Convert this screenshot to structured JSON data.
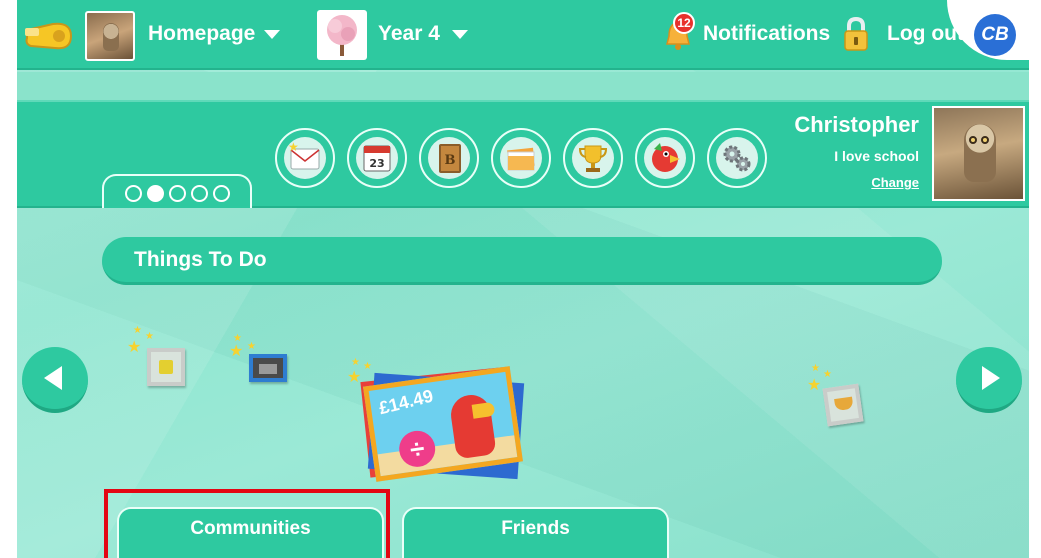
{
  "topbar": {
    "homepage_label": "Homepage",
    "year_label": "Year 4",
    "notifications_label": "Notifications",
    "notifications_count": "12",
    "logout_label": "Log out",
    "logo_text": "CB"
  },
  "profile": {
    "name": "Christopher",
    "status": "I love school",
    "change_label": "Change"
  },
  "toolbar": {
    "calendar_day": "23",
    "book_letter": "B",
    "icons": [
      "mail-icon",
      "calendar-icon",
      "book-icon",
      "folders-icon",
      "trophy-icon",
      "parrot-icon",
      "settings-icon"
    ]
  },
  "carousel": {
    "page_count": 5,
    "active_page": 2
  },
  "todo": {
    "title": "Things To Do",
    "featured_price": "£14.49",
    "divide_symbol": "÷"
  },
  "tabs": {
    "communities_label": "Communities",
    "friends_label": "Friends"
  },
  "colors": {
    "primary": "#2ec9a0",
    "background": "#9ee9d6",
    "badge": "#e8312c",
    "highlight": "#e30613"
  }
}
